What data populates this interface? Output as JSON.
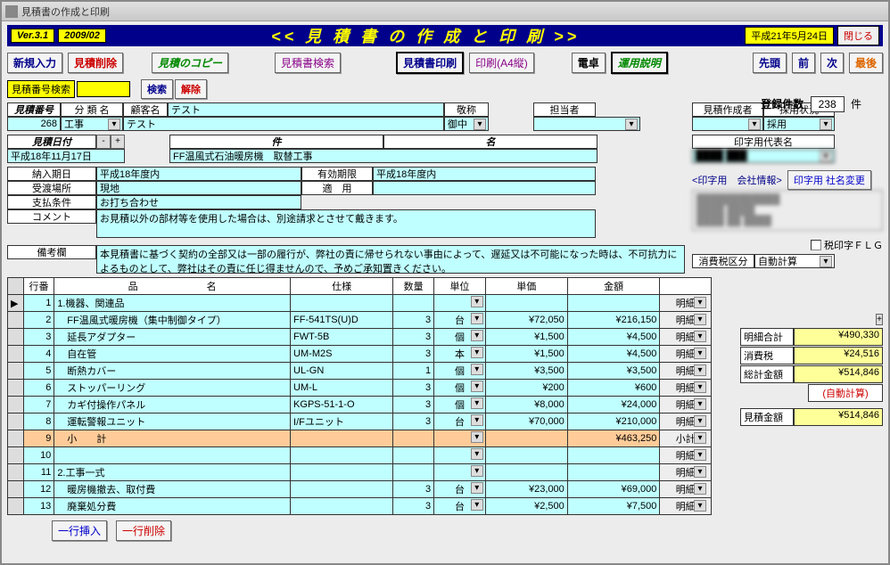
{
  "window_title": "見積書の作成と印刷",
  "version": {
    "ver": "Ver.3.1",
    "date": "2009/02"
  },
  "app_title": "<< 見 積 書 の 作 成 と 印 刷 >>",
  "today": "平成21年5月24日",
  "close": "閉じる",
  "toolbar": {
    "new": "新規入力",
    "delete": "見積削除",
    "copy": "見積のコピー",
    "search_est": "見積書検索",
    "print_est": "見積書印刷",
    "print_a4": "印刷(A4縦)",
    "calc": "電卓",
    "manual": "運用説明",
    "first": "先頭",
    "prev": "前",
    "next": "次",
    "last": "最後"
  },
  "search": {
    "label": "見積番号検索",
    "go": "検索",
    "clear": "解除"
  },
  "register": {
    "label": "登録件数",
    "count": "238",
    "unit": "件"
  },
  "headers": {
    "est_no": "見積番号",
    "category": "分 類 名",
    "customer": "顧客名",
    "title_h": "敬称",
    "person": "担当者",
    "author": "見積作成者",
    "status": "採用状況",
    "est_date": "見積日付",
    "subject": "件",
    "name": "名",
    "print_name": "印字用代表名",
    "delivery": "納入期日",
    "valid": "有効期限",
    "place": "受渡場所",
    "apply": "適　用",
    "payment": "支払条件",
    "comment": "コメント",
    "remarks": "備考欄",
    "company_info": "<印字用　会社情報>",
    "company_btn": "印字用 社名変更",
    "tax_flg": "税印字ＦＬＧ",
    "tax_class": "消費税区分"
  },
  "values": {
    "est_no": "268",
    "category": "工事",
    "customer": "テスト",
    "customer2": "テスト",
    "title_h": "御中",
    "est_date": "平成18年11月17日",
    "subject": "FF温風式石油暖房機　取替工事",
    "delivery": "平成18年度内",
    "valid": "平成18年度内",
    "place": "現地",
    "payment": "お打ち合わせ",
    "comment": "お見積以外の部材等を使用した場合は、別途請求とさせて戴きます。",
    "remarks": "本見積書に基づく契約の全部又は一部の履行が、弊社の責に帰せられない事由によって、遅延又は不可能になった時は、不可抗力によるものとして、弊社はその責に任じ得ませんので、予めご承知置きください。",
    "status": "採用",
    "tax_class": "自動計算"
  },
  "table": {
    "cols": {
      "row": "行番",
      "name": "品　　　　　　　名",
      "spec": "仕様",
      "qty": "数量",
      "unit": "単位",
      "price": "単価",
      "amount": "金額",
      "detail": ""
    },
    "rows": [
      {
        "n": "1",
        "name": "1.機器、関連品",
        "spec": "",
        "qty": "",
        "unit": "",
        "price": "",
        "amount": "",
        "btn": "明細"
      },
      {
        "n": "2",
        "name": "　FF温風式暖房機（集中制御タイプ）",
        "spec": "FF-541TS(U)D",
        "qty": "3",
        "unit": "台",
        "price": "¥72,050",
        "amount": "¥216,150",
        "btn": "明細"
      },
      {
        "n": "3",
        "name": "　延長アダプター",
        "spec": "FWT-5B",
        "qty": "3",
        "unit": "個",
        "price": "¥1,500",
        "amount": "¥4,500",
        "btn": "明細"
      },
      {
        "n": "4",
        "name": "　自在管",
        "spec": "UM-M2S",
        "qty": "3",
        "unit": "本",
        "price": "¥1,500",
        "amount": "¥4,500",
        "btn": "明細"
      },
      {
        "n": "5",
        "name": "　断熱カバー",
        "spec": "UL-GN",
        "qty": "1",
        "unit": "個",
        "price": "¥3,500",
        "amount": "¥3,500",
        "btn": "明細"
      },
      {
        "n": "6",
        "name": "　ストッパーリング",
        "spec": "UM-L",
        "qty": "3",
        "unit": "個",
        "price": "¥200",
        "amount": "¥600",
        "btn": "明細"
      },
      {
        "n": "7",
        "name": "　カギ付操作パネル",
        "spec": "KGPS-51-1-O",
        "qty": "3",
        "unit": "個",
        "price": "¥8,000",
        "amount": "¥24,000",
        "btn": "明細"
      },
      {
        "n": "8",
        "name": "　運転警報ユニット",
        "spec": "I/Fユニット",
        "qty": "3",
        "unit": "台",
        "price": "¥70,000",
        "amount": "¥210,000",
        "btn": "明細"
      },
      {
        "n": "9",
        "name": "　小　　計",
        "spec": "",
        "qty": "",
        "unit": "",
        "price": "",
        "amount": "¥463,250",
        "btn": "小計",
        "sub": true
      },
      {
        "n": "10",
        "name": "",
        "spec": "",
        "qty": "",
        "unit": "",
        "price": "",
        "amount": "",
        "btn": "明細"
      },
      {
        "n": "11",
        "name": "2.工事一式",
        "spec": "",
        "qty": "",
        "unit": "",
        "price": "",
        "amount": "",
        "btn": "明細"
      },
      {
        "n": "12",
        "name": "　暖房機撤去、取付費",
        "spec": "",
        "qty": "3",
        "unit": "台",
        "price": "¥23,000",
        "amount": "¥69,000",
        "btn": "明細"
      },
      {
        "n": "13",
        "name": "　廃棄処分費",
        "spec": "",
        "qty": "3",
        "unit": "台",
        "price": "¥2,500",
        "amount": "¥7,500",
        "btn": "明細"
      }
    ]
  },
  "totals": {
    "subtotal_l": "明細合計",
    "subtotal": "¥490,330",
    "tax_l": "消費税",
    "tax": "¥24,516",
    "total_l": "総計金額",
    "total": "¥514,846",
    "auto": "(自動計算)",
    "est_l": "見積金額",
    "est": "¥514,846"
  },
  "bottom": {
    "insert": "一行挿入",
    "delrow": "一行削除"
  }
}
